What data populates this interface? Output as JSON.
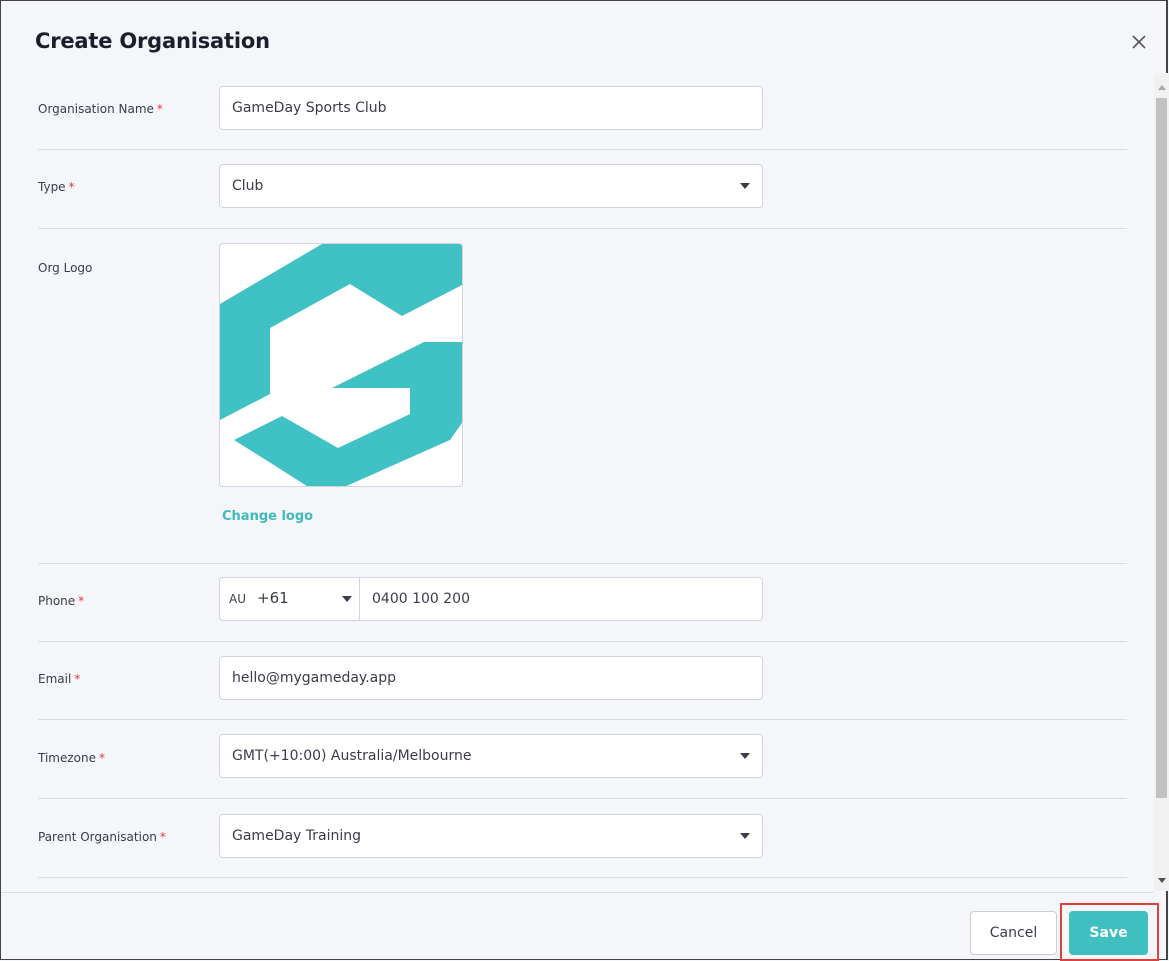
{
  "dialog": {
    "title": "Create Organisation",
    "close_icon": "close-icon"
  },
  "fields": {
    "org_name": {
      "label": "Organisation Name",
      "required": "*",
      "value": "GameDay Sports Club"
    },
    "type": {
      "label": "Type",
      "required": "*",
      "value": "Club"
    },
    "org_logo": {
      "label": "Org Logo",
      "change_label": "Change logo",
      "logo_color": "#40c1c4"
    },
    "phone": {
      "label": "Phone",
      "required": "*",
      "country_code": "AU",
      "dial_code": "+61",
      "value": "0400 100 200"
    },
    "email": {
      "label": "Email",
      "required": "*",
      "value": "hello@mygameday.app"
    },
    "timezone": {
      "label": "Timezone",
      "required": "*",
      "value": "GMT(+10:00) Australia/Melbourne"
    },
    "parent_org": {
      "label": "Parent Organisation",
      "required": "*",
      "value": "GameDay Training"
    }
  },
  "footer": {
    "cancel_label": "Cancel",
    "save_label": "Save"
  },
  "colors": {
    "accent": "#3fbfbf",
    "required": "#e03b46",
    "highlight": "#e0403f"
  }
}
